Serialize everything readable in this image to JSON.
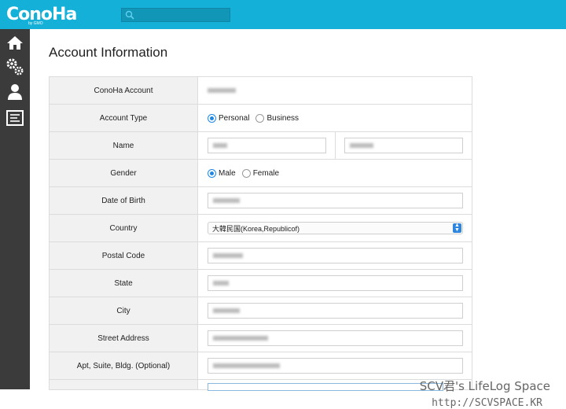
{
  "app": {
    "logo": "ConoHa",
    "logo_sub": "by GMO"
  },
  "search": {
    "placeholder": ""
  },
  "sidebar": {
    "items": [
      {
        "icon": "home-icon"
      },
      {
        "icon": "gears-icon"
      },
      {
        "icon": "user-icon"
      },
      {
        "icon": "list-icon"
      }
    ]
  },
  "page": {
    "title": "Account Information"
  },
  "form": {
    "conoha_account": {
      "label": "ConoHa Account",
      "value": ""
    },
    "account_type": {
      "label": "Account Type",
      "options": [
        "Personal",
        "Business"
      ],
      "selected": "Personal"
    },
    "name": {
      "label": "Name",
      "first": "",
      "last": ""
    },
    "gender": {
      "label": "Gender",
      "options": [
        "Male",
        "Female"
      ],
      "selected": "Male"
    },
    "dob": {
      "label": "Date of Birth",
      "value": ""
    },
    "country": {
      "label": "Country",
      "value": "大韓民国(Korea,Republicof)"
    },
    "postal": {
      "label": "Postal Code",
      "value": ""
    },
    "state": {
      "label": "State",
      "value": ""
    },
    "city": {
      "label": "City",
      "value": ""
    },
    "street": {
      "label": "Street Address",
      "value": ""
    },
    "apt": {
      "label": "Apt, Suite, Bldg. (Optional)",
      "value": ""
    }
  },
  "watermark": {
    "line1": "SCV君's LifeLog Space",
    "line2": "http://SCVSPACE.KR"
  },
  "colors": {
    "topbar": "#14b0d8",
    "sidebar": "#3b3b3b",
    "accent": "#1e88e5"
  }
}
